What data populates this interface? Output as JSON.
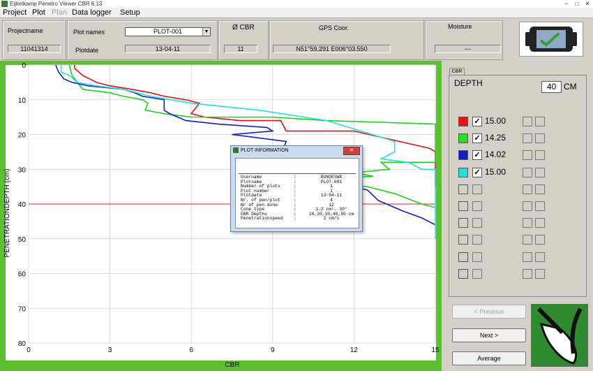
{
  "window": {
    "title": "Eijkelkamp Penetro Viewer CBR  6.13",
    "minimize": "–",
    "maximize": "□",
    "close": "✕"
  },
  "menu": [
    {
      "label": "Project",
      "enabled": true
    },
    {
      "label": "Plot",
      "enabled": true
    },
    {
      "label": "Plan",
      "enabled": false
    },
    {
      "label": "Data logger",
      "enabled": true
    },
    {
      "label": "Setup",
      "enabled": true
    }
  ],
  "header": {
    "projectname_label": "Projectname",
    "projectname_value": "11041314",
    "plotnames_label": "Plot names",
    "plotnames_value": "PLOT-001",
    "plotdate_label": "Plotdate",
    "plotdate_value": "13-04-11",
    "cbr_label": "Ø CBR",
    "cbr_value": "11",
    "gps_label": "GPS Coor.",
    "gps_value": "N51°59.291 E006°03.550",
    "moisture_label": "Moisture",
    "moisture_value": "---"
  },
  "chart_data": {
    "type": "line",
    "xlabel": "CBR",
    "ylabel": "PENETRATIONDEPTH (cm)",
    "xlim": [
      0,
      15
    ],
    "ylim": [
      80,
      0
    ],
    "x_ticks": [
      "0",
      "3",
      "6",
      "9",
      "12",
      "15"
    ],
    "y_ticks": [
      "0",
      "10",
      "20",
      "30",
      "40",
      "50",
      "60",
      "70",
      "80"
    ],
    "grid": true,
    "reference_line_depth": 40,
    "series": [
      {
        "color": "#e01010",
        "x": [
          1.7,
          1.7,
          2.0,
          2.5,
          3.0,
          3.8,
          4.5,
          5.0,
          5.8,
          6.3,
          6.0,
          6.5,
          7.8,
          9.3,
          9.5,
          12.0,
          14.8,
          15.0,
          15.0
        ],
        "y": [
          0,
          1,
          3,
          5,
          6,
          7,
          8,
          9,
          10,
          11,
          14,
          15,
          16,
          16,
          19,
          19,
          24,
          25,
          35
        ]
      },
      {
        "color": "#1fd01f",
        "x": [
          1.5,
          1.6,
          1.8,
          2.0,
          3.0,
          3.5,
          4.2,
          4.4,
          4.3,
          5.0,
          6.0,
          9.0,
          11.0,
          15.0,
          15.0,
          13.0,
          13.3,
          12.0,
          12.7,
          11.0,
          10.5,
          12.5,
          13.5,
          14.5,
          15.0
        ],
        "y": [
          0,
          3,
          5,
          7,
          8,
          9,
          10,
          11,
          13,
          14,
          15,
          15,
          16,
          17,
          28,
          28,
          30,
          31,
          32,
          33,
          34,
          35,
          37,
          40,
          41
        ]
      },
      {
        "color": "#1020c0",
        "x": [
          1.0,
          1.1,
          1.3,
          1.6,
          2.2,
          3.5,
          3.9,
          4.2,
          5.0,
          5.0,
          5.2,
          5.8,
          7.0,
          8.8,
          9.0,
          7.5,
          9.5,
          9.4,
          10.0,
          10.9,
          10.3,
          11.2,
          12.0,
          12.5,
          12.9,
          13.8,
          14.5,
          15.0
        ],
        "y": [
          0,
          2,
          4,
          5,
          6,
          7,
          8,
          9,
          10,
          13,
          14,
          16,
          17,
          18,
          19,
          20,
          22,
          24,
          25,
          27,
          30,
          33,
          35,
          36,
          39,
          42,
          44,
          46
        ]
      },
      {
        "color": "#20e0e0",
        "x": [
          1.2,
          1.2,
          1.5,
          1.8,
          2.5,
          3.5,
          4.5,
          6.0,
          8.5,
          11.0,
          13.5,
          13.5,
          13.0,
          14.0,
          14.5,
          15.0,
          15.0
        ],
        "y": [
          0,
          2,
          3,
          5,
          6,
          7,
          9,
          11,
          13,
          16,
          22,
          25,
          27,
          28,
          30,
          30,
          50
        ]
      }
    ]
  },
  "right_panel": {
    "tab_label": "CBR",
    "depth_label": "DEPTH",
    "depth_value": "40",
    "depth_unit": "CM",
    "rows": [
      {
        "color": "#ee1010",
        "checked": true,
        "value": "15.00"
      },
      {
        "color": "#22dd22",
        "checked": true,
        "value": "14.25"
      },
      {
        "color": "#1020c0",
        "checked": true,
        "value": "14.02"
      },
      {
        "color": "#22e0e0",
        "checked": true,
        "value": "15.00"
      },
      {
        "color": "",
        "checked": false,
        "value": ""
      },
      {
        "color": "",
        "checked": false,
        "value": ""
      },
      {
        "color": "",
        "checked": false,
        "value": ""
      },
      {
        "color": "",
        "checked": false,
        "value": ""
      },
      {
        "color": "",
        "checked": false,
        "value": ""
      },
      {
        "color": "",
        "checked": false,
        "value": ""
      }
    ],
    "previous_label": "< Previous",
    "next_label": "Next >",
    "average_label": "Average"
  },
  "dialog": {
    "title": "PLOT INFORMATION",
    "close": "✕",
    "rows": [
      {
        "key": "Username",
        "sep": ":",
        "value": "BUNDESWR"
      },
      {
        "key": "Plotname",
        "sep": ":",
        "value": "PLOT-001"
      },
      {
        "key": "Number of plots",
        "sep": ":",
        "value": "1"
      },
      {
        "key": "Plot number",
        "sep": ":",
        "value": "1"
      },
      {
        "key": "Plotdate",
        "sep": ":",
        "value": "13-04-11"
      },
      {
        "key": "Nr. of pen/plot",
        "sep": ":",
        "value": "4"
      },
      {
        "key": "Nr of pen done",
        "sep": ":",
        "value": "12"
      },
      {
        "key": "Cone type",
        "sep": ":",
        "value": "1.2 cm². 30°"
      },
      {
        "key": "CBR Depths",
        "sep": ":",
        "value": "10,20,30,40,50 cm"
      },
      {
        "key": "Penetrationspeed",
        "sep": ":",
        "value": "2 cm/s"
      }
    ]
  }
}
